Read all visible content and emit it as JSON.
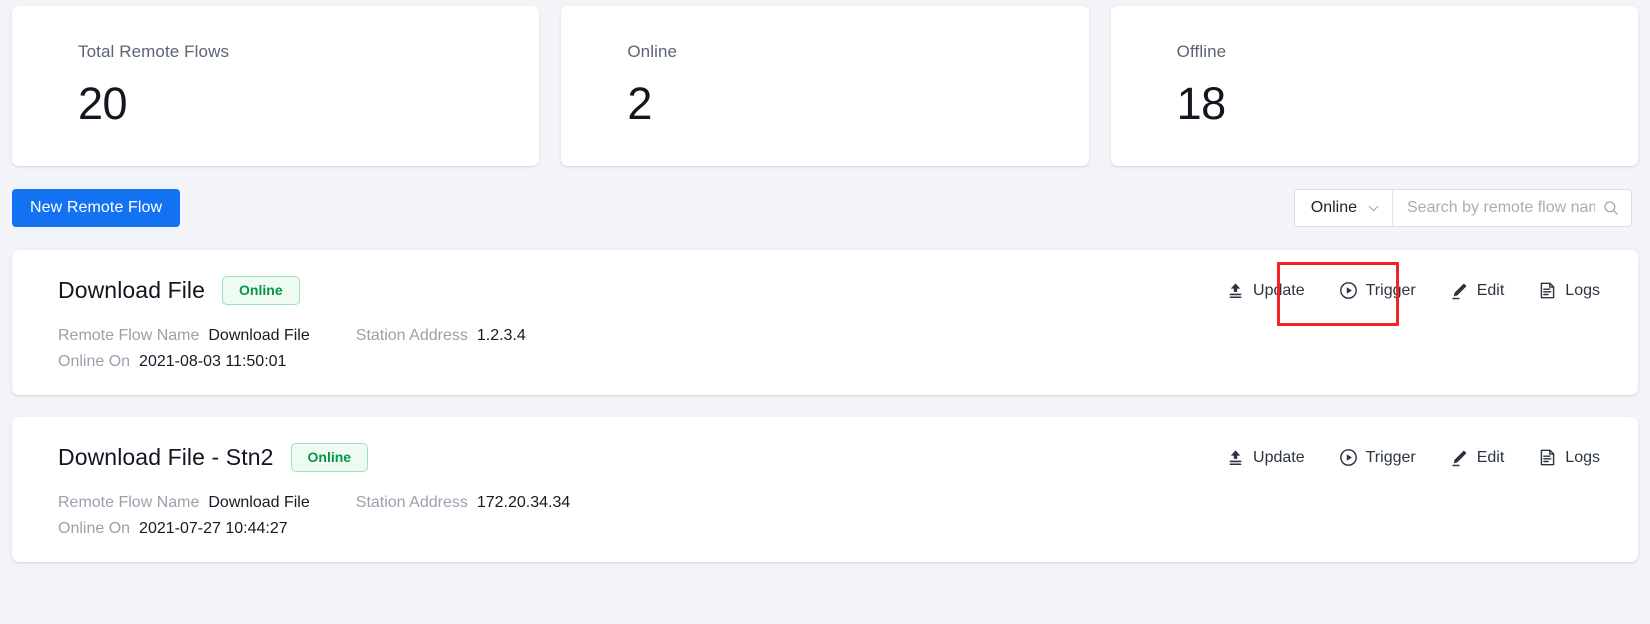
{
  "stats": [
    {
      "label": "Total Remote Flows",
      "value": "20"
    },
    {
      "label": "Online",
      "value": "2"
    },
    {
      "label": "Offline",
      "value": "18"
    }
  ],
  "toolbar": {
    "new_flow_label": "New Remote Flow",
    "filter": {
      "selected": "Online",
      "icon": "chevron-down-icon"
    },
    "search": {
      "placeholder": "Search by remote flow name",
      "value": "",
      "icon": "search-icon"
    }
  },
  "flows": [
    {
      "title": "Download File",
      "status": "Online",
      "actions": [
        {
          "label": "Update",
          "icon": "upload-icon"
        },
        {
          "label": "Trigger",
          "icon": "play-circle-icon"
        },
        {
          "label": "Edit",
          "icon": "pencil-icon"
        },
        {
          "label": "Logs",
          "icon": "document-lines-icon"
        }
      ],
      "meta": {
        "name_label": "Remote Flow Name",
        "name_value": "Download File",
        "station_label": "Station Address",
        "station_value": "1.2.3.4",
        "online_label": "Online On",
        "online_value": "2021-08-03 11:50:01"
      }
    },
    {
      "title": "Download File - Stn2",
      "status": "Online",
      "actions": [
        {
          "label": "Update",
          "icon": "upload-icon"
        },
        {
          "label": "Trigger",
          "icon": "play-circle-icon"
        },
        {
          "label": "Edit",
          "icon": "pencil-icon"
        },
        {
          "label": "Logs",
          "icon": "document-lines-icon"
        }
      ],
      "meta": {
        "name_label": "Remote Flow Name",
        "name_value": "Download File",
        "station_label": "Station Address",
        "station_value": "172.20.34.34",
        "online_label": "Online On",
        "online_value": "2021-07-27 10:44:27"
      }
    }
  ],
  "annotation": {
    "target": "Trigger",
    "color": "#f02424"
  },
  "colors": {
    "accent": "#1272f2",
    "status_online_text": "#059449",
    "status_online_bg": "#eefbf2",
    "status_online_border": "#9ee2b6",
    "page_bg": "#f3f4f8",
    "card_bg": "#ffffff",
    "highlight": "#f02424"
  }
}
